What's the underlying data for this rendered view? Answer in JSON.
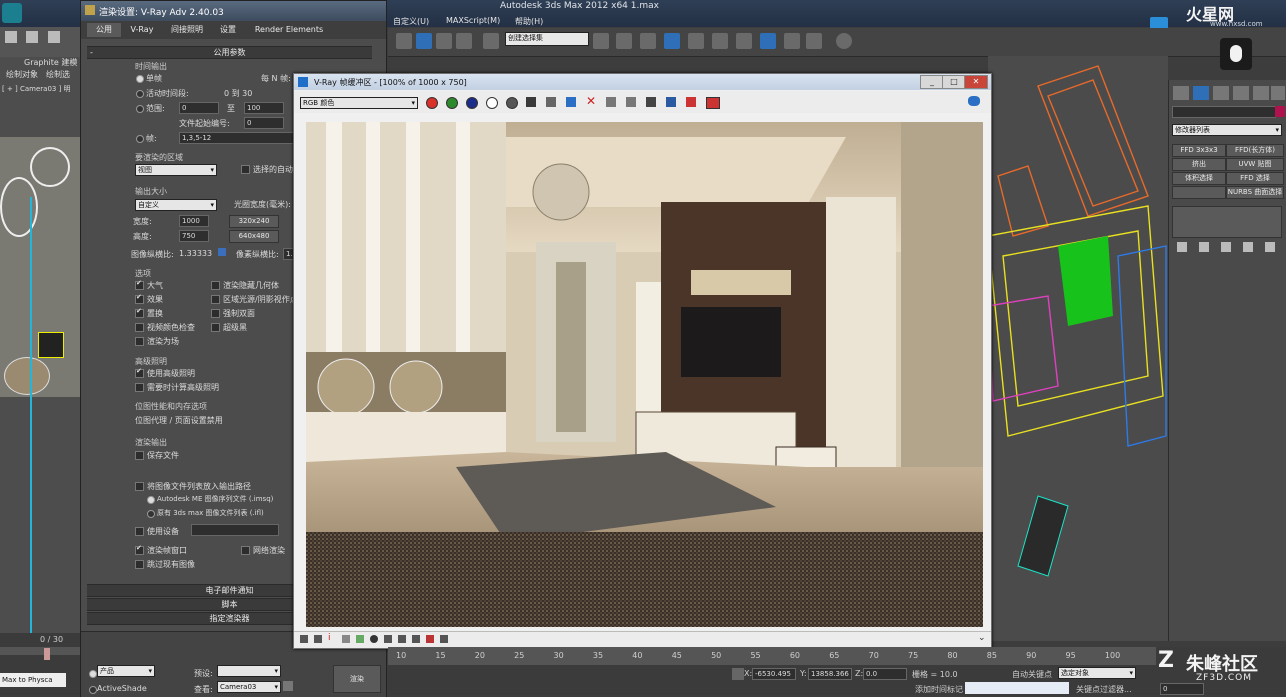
{
  "app": {
    "title": "Autodesk 3ds Max  2012 x64    1.max",
    "menus": [
      "自定义(U)",
      "MAXScript(M)",
      "帮助(H)"
    ],
    "named_selection": "创建选择集",
    "brand": "火星网",
    "brand_url": "www.hxsd.com",
    "watermark_cn": "朱峰社区",
    "watermark_url": "ZF3D.COM",
    "accent": "#1f6fc9"
  },
  "left_strip": {
    "graphite": "Graphite 建模",
    "tab1": "绘制对象",
    "tab2": "绘制选",
    "camera_label": "[ + ] Camera03 ] 明",
    "frame": "0 / 30",
    "script_line": "Max to Physca"
  },
  "render_setup": {
    "title": "渲染设置: V-Ray Adv 2.40.03",
    "tabs": [
      "公用",
      "V-Ray",
      "间接照明",
      "设置",
      "Render Elements"
    ],
    "rollout_common": "公用参数",
    "time_output": {
      "header": "时间输出",
      "single": "单帧",
      "every_n": "每 N 帧:",
      "active_segment": "活动时间段:",
      "active_range": "0 到 30",
      "range": "范围:",
      "range_from": "0",
      "range_to_label": "至",
      "range_to": "100",
      "file_start": "文件起始编号:",
      "file_start_val": "0",
      "frames": "帧:",
      "frames_val": "1,3,5-12"
    },
    "area": {
      "header": "要渲染的区域",
      "value": "视图",
      "auto_region": "选择的自动区"
    },
    "output_size": {
      "header": "输出大小",
      "preset": "自定义",
      "aperture": "光圈宽度(毫米):",
      "width_label": "宽度:",
      "width": "1000",
      "height_label": "高度:",
      "height": "750",
      "preset1": "320x240",
      "preset2": "640x480",
      "aspect_label": "图像纵横比:",
      "aspect": "1.33333",
      "pixel_aspect_label": "像素纵横比:",
      "pixel_aspect": "1.0"
    },
    "options": {
      "header": "选项",
      "atmos": "大气",
      "effects": "效果",
      "displacement": "置换",
      "video_check": "视频颜色检查",
      "render_fields": "渲染为场",
      "hidden_geo": "渲染隐藏几何体",
      "area_lights": "区域光源/阴影视作点",
      "force_2side": "强制双面",
      "super_black": "超级黑"
    },
    "advanced_lighting": {
      "header": "高级照明",
      "use": "使用高级照明",
      "compute": "需要时计算高级照明"
    },
    "bitmap_perf": {
      "header": "位图性能和内存选项",
      "value": "位图代理 / 页面设置禁用"
    },
    "render_output": {
      "header": "渲染输出",
      "save_file": "保存文件",
      "put_image_seq": "将图像文件列表放入输出路径",
      "autodesk_seq": "Autodesk ME 图像序列文件 (.imsq)",
      "legacy_seq": "原有 3ds max 图像文件列表 (.ifl)",
      "use_device": "使用设备",
      "frame_window": "渲染帧窗口",
      "net_render": "网络渲染",
      "skip_existing": "跳过现有图像"
    },
    "rollouts_bottom": [
      "电子邮件通知",
      "脚本",
      "指定渲染器"
    ],
    "bottom": {
      "product": "产品",
      "activeshade": "ActiveShade",
      "preset_label": "预设:",
      "view_label": "查看:",
      "view_value": "Camera03",
      "render_btn": "渲染"
    }
  },
  "vfb": {
    "title": "V-Ray 帧缓冲区 - [100% of 1000 x 750]",
    "channel": "RGB 颜色"
  },
  "command_panel": {
    "modifier_list": "修改器列表",
    "buttons": [
      "FFD 3x3x3",
      "FFD(长方体)",
      "挤出",
      "UVW 贴图",
      "体积选择",
      "FFD 选择",
      "",
      "NURBS 曲面选择"
    ]
  },
  "timeline": {
    "ticks": [
      "10",
      "15",
      "20",
      "25",
      "30",
      "35",
      "40",
      "45",
      "50",
      "55",
      "60",
      "65",
      "70",
      "75",
      "80",
      "85",
      "90",
      "95",
      "100"
    ]
  },
  "status": {
    "x_label": "X:",
    "x": "-6530.495",
    "y_label": "Y:",
    "y": "13858.366",
    "z_label": "Z:",
    "z": "0.0",
    "grid": "栅格 = 10.0",
    "auto_key": "自动关键点",
    "selected": "选定对象",
    "add_time_tag": "添加时间标记",
    "key_filter": "关键点过滤器...",
    "frame": "0"
  }
}
